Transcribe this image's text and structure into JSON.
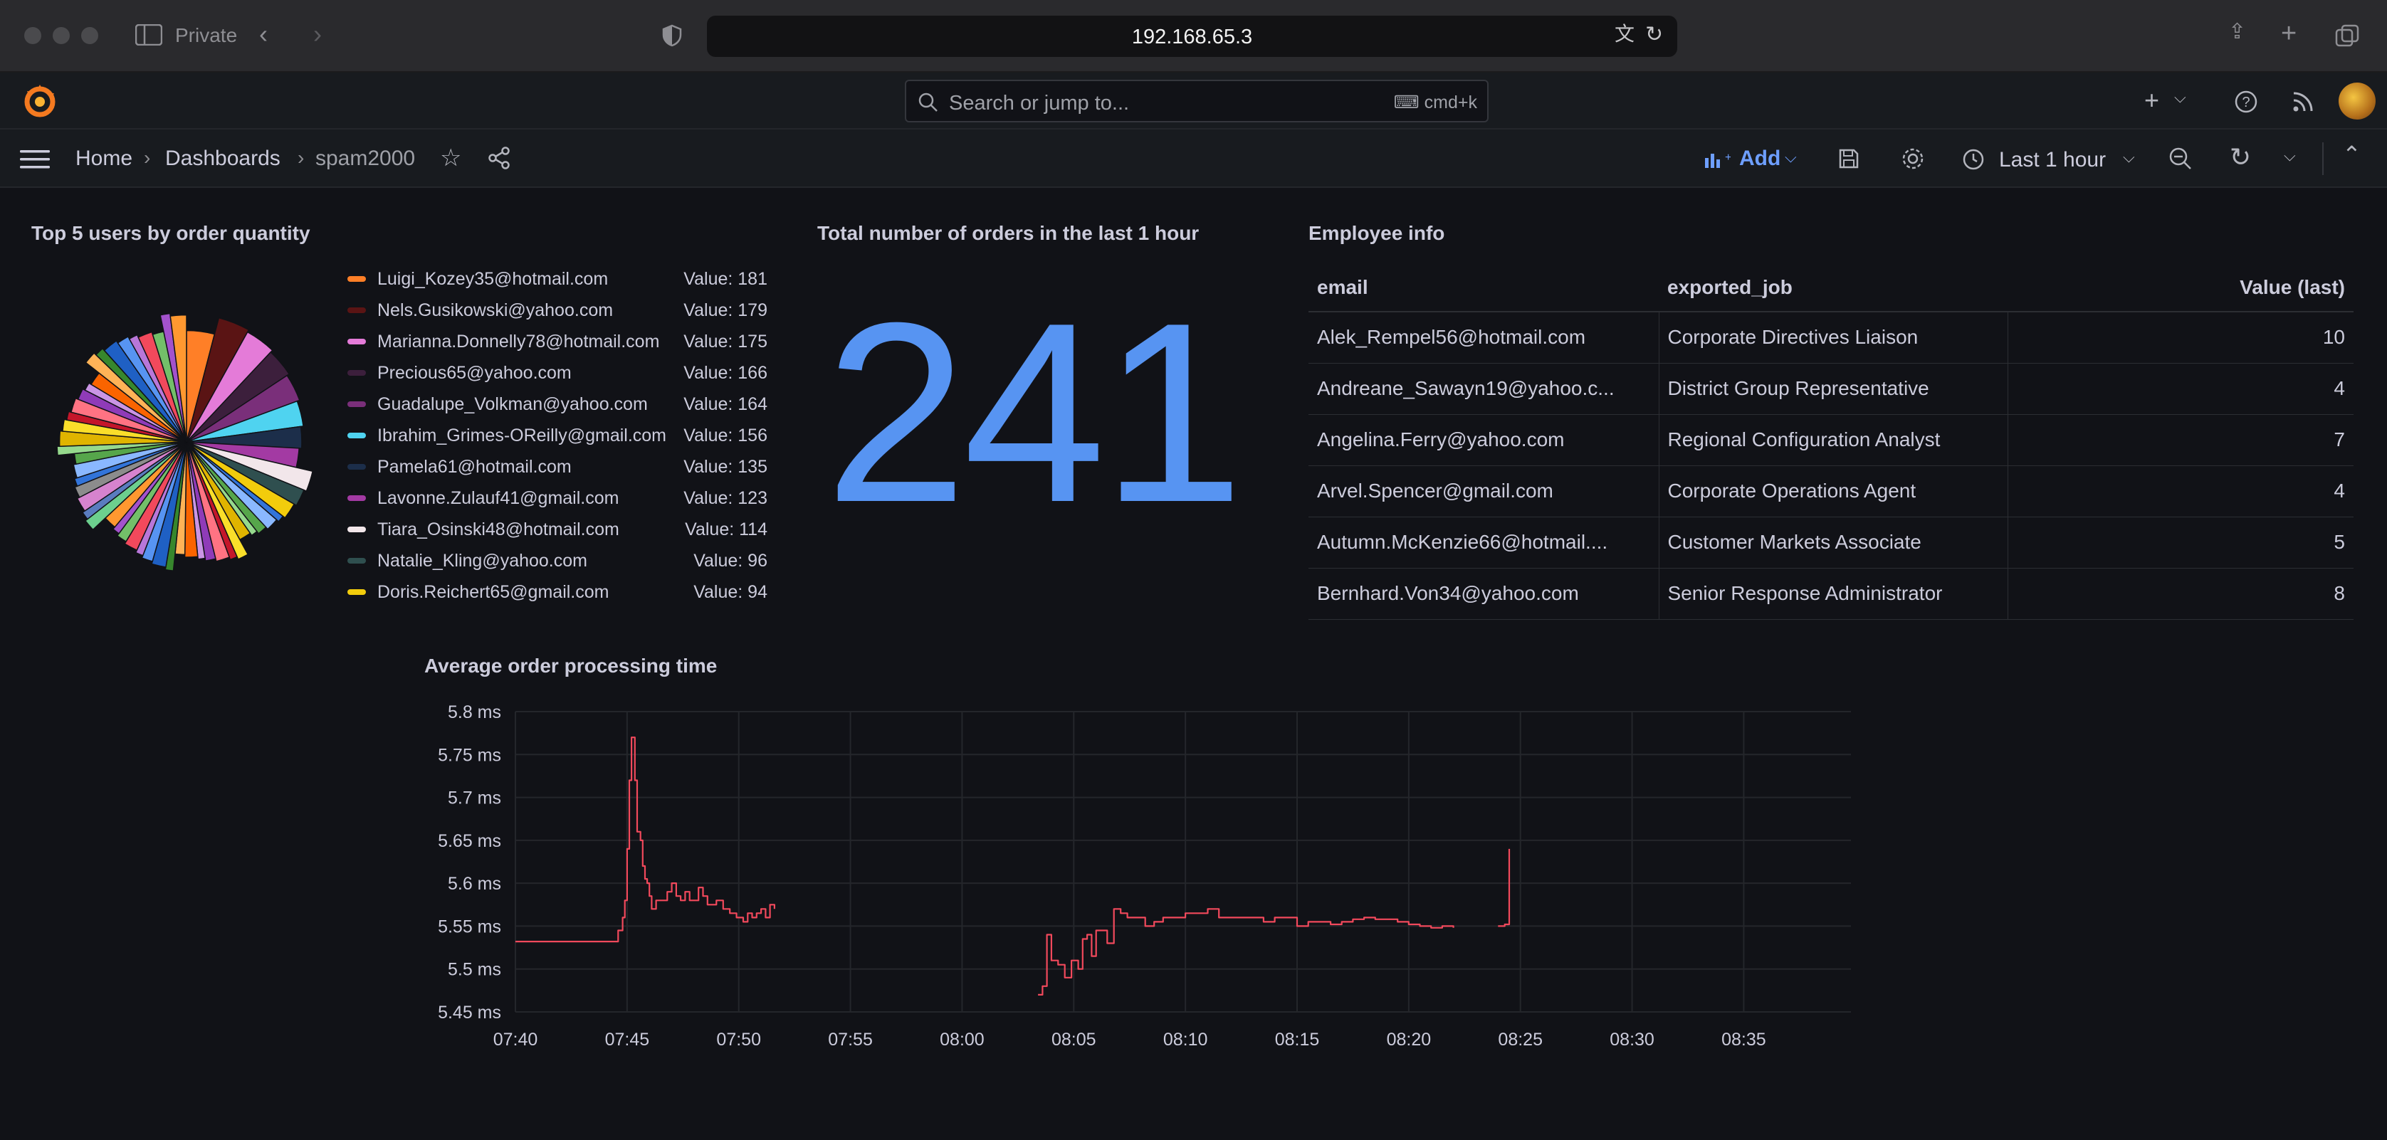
{
  "browser": {
    "private_label": "Private",
    "url": "192.168.65.3"
  },
  "topbar": {
    "search_placeholder": "Search or jump to...",
    "search_shortcut": "cmd+k"
  },
  "navbar": {
    "breadcrumbs": [
      "Home",
      "Dashboards",
      "spam2000"
    ],
    "add_label": "Add",
    "time_range": "Last 1 hour",
    "accent": "#6e9fff"
  },
  "pie_panel": {
    "title": "Top 5 users by order quantity",
    "legend": [
      {
        "name": "Luigi_Kozey35@hotmail.com",
        "value": "Value: 181",
        "color": "#ff7f27"
      },
      {
        "name": "Nels.Gusikowski@yahoo.com",
        "value": "Value: 179",
        "color": "#5a1414"
      },
      {
        "name": "Marianna.Donnelly78@hotmail.com",
        "value": "Value: 175",
        "color": "#e47bd8"
      },
      {
        "name": "Precious65@yahoo.com",
        "value": "Value: 166",
        "color": "#3c1f3c"
      },
      {
        "name": "Guadalupe_Volkman@yahoo.com",
        "value": "Value: 164",
        "color": "#7a2f7a"
      },
      {
        "name": "Ibrahim_Grimes-OReilly@gmail.com",
        "value": "Value: 156",
        "color": "#4fd3f0"
      },
      {
        "name": "Pamela61@hotmail.com",
        "value": "Value: 135",
        "color": "#1c2e4a"
      },
      {
        "name": "Lavonne.Zulauf41@gmail.com",
        "value": "Value: 123",
        "color": "#a33aa3"
      },
      {
        "name": "Tiara_Osinski48@hotmail.com",
        "value": "Value: 114",
        "color": "#f2e6ea"
      },
      {
        "name": "Natalie_Kling@yahoo.com",
        "value": "Value: 96",
        "color": "#2f4f4f"
      },
      {
        "name": "Doris.Reichert65@gmail.com",
        "value": "Value: 94",
        "color": "#f2cc0c"
      }
    ]
  },
  "stat_panel": {
    "title": "Total number of orders in the last 1 hour",
    "value": "241",
    "color": "#5794f2"
  },
  "table_panel": {
    "title": "Employee info",
    "columns": [
      "email",
      "exported_job",
      "Value (last)"
    ],
    "rows": [
      [
        "Alek_Rempel56@hotmail.com",
        "Corporate Directives Liaison",
        "10"
      ],
      [
        "Andreane_Sawayn19@yahoo.c...",
        "District Group Representative",
        "4"
      ],
      [
        "Angelina.Ferry@yahoo.com",
        "Regional Configuration Analyst",
        "7"
      ],
      [
        "Arvel.Spencer@gmail.com",
        "Corporate Operations Agent",
        "4"
      ],
      [
        "Autumn.McKenzie66@hotmail....",
        "Customer Markets Associate",
        "5"
      ],
      [
        "Bernhard.Von34@yahoo.com",
        "Senior Response Administrator",
        "8"
      ]
    ]
  },
  "chart_data": {
    "type": "line",
    "title": "Average order processing time",
    "ylim": [
      5.45,
      5.8
    ],
    "y_ticks": [
      "5.8 ms",
      "5.75 ms",
      "5.7 ms",
      "5.65 ms",
      "5.6 ms",
      "5.55 ms",
      "5.5 ms",
      "5.45 ms"
    ],
    "x_ticks": [
      "07:40",
      "07:45",
      "07:50",
      "07:55",
      "08:00",
      "08:05",
      "08:10",
      "08:15",
      "08:20",
      "08:25",
      "08:30",
      "08:35"
    ],
    "grid": true,
    "line_color": "#f2495c",
    "series": [
      {
        "segments": [
          [
            [
              0,
              5.532
            ],
            [
              4.4,
              5.532
            ],
            [
              4.6,
              5.545
            ],
            [
              4.8,
              5.56
            ],
            [
              4.9,
              5.58
            ],
            [
              5.0,
              5.64
            ],
            [
              5.1,
              5.72
            ],
            [
              5.2,
              5.77
            ],
            [
              5.35,
              5.72
            ],
            [
              5.45,
              5.66
            ],
            [
              5.6,
              5.65
            ],
            [
              5.7,
              5.62
            ],
            [
              5.8,
              5.605
            ],
            [
              5.9,
              5.6
            ],
            [
              6.0,
              5.585
            ],
            [
              6.1,
              5.57
            ],
            [
              6.3,
              5.58
            ],
            [
              6.6,
              5.58
            ],
            [
              6.8,
              5.59
            ],
            [
              7.0,
              5.6
            ],
            [
              7.2,
              5.585
            ],
            [
              7.4,
              5.58
            ],
            [
              7.6,
              5.59
            ],
            [
              7.8,
              5.58
            ],
            [
              8.0,
              5.58
            ],
            [
              8.2,
              5.595
            ],
            [
              8.4,
              5.585
            ],
            [
              8.6,
              5.575
            ],
            [
              9.0,
              5.58
            ],
            [
              9.3,
              5.57
            ],
            [
              9.6,
              5.565
            ],
            [
              9.9,
              5.56
            ],
            [
              10.2,
              5.555
            ],
            [
              10.4,
              5.565
            ],
            [
              10.6,
              5.56
            ],
            [
              10.8,
              5.565
            ],
            [
              11.0,
              5.57
            ],
            [
              11.2,
              5.56
            ],
            [
              11.4,
              5.575
            ],
            [
              11.6,
              5.57
            ]
          ],
          [
            [
              23.4,
              5.47
            ],
            [
              23.6,
              5.48
            ],
            [
              23.8,
              5.54
            ],
            [
              24.0,
              5.51
            ],
            [
              24.3,
              5.505
            ],
            [
              24.6,
              5.49
            ],
            [
              24.9,
              5.51
            ],
            [
              25.2,
              5.5
            ],
            [
              25.4,
              5.535
            ],
            [
              25.6,
              5.54
            ],
            [
              25.8,
              5.515
            ],
            [
              26.0,
              5.545
            ],
            [
              26.3,
              5.545
            ],
            [
              26.5,
              5.53
            ],
            [
              26.8,
              5.57
            ],
            [
              27.1,
              5.565
            ],
            [
              27.4,
              5.56
            ],
            [
              27.8,
              5.56
            ],
            [
              28.2,
              5.55
            ],
            [
              28.6,
              5.555
            ],
            [
              29.0,
              5.56
            ],
            [
              29.5,
              5.56
            ],
            [
              30.0,
              5.565
            ],
            [
              30.5,
              5.565
            ],
            [
              31.0,
              5.57
            ],
            [
              31.5,
              5.56
            ],
            [
              32.0,
              5.56
            ],
            [
              32.5,
              5.56
            ],
            [
              33.0,
              5.56
            ],
            [
              33.5,
              5.555
            ],
            [
              34.0,
              5.56
            ],
            [
              34.5,
              5.56
            ],
            [
              35.0,
              5.55
            ],
            [
              35.5,
              5.555
            ],
            [
              36.0,
              5.555
            ],
            [
              36.5,
              5.552
            ],
            [
              37.0,
              5.555
            ],
            [
              37.5,
              5.558
            ],
            [
              38.0,
              5.56
            ],
            [
              38.5,
              5.558
            ],
            [
              39.0,
              5.558
            ],
            [
              39.5,
              5.555
            ],
            [
              40.0,
              5.552
            ],
            [
              40.5,
              5.55
            ],
            [
              41.0,
              5.548
            ],
            [
              41.5,
              5.55
            ],
            [
              42.0,
              5.548
            ]
          ],
          [
            [
              44.0,
              5.55
            ],
            [
              44.3,
              5.552
            ],
            [
              44.5,
              5.64
            ]
          ]
        ]
      }
    ]
  }
}
